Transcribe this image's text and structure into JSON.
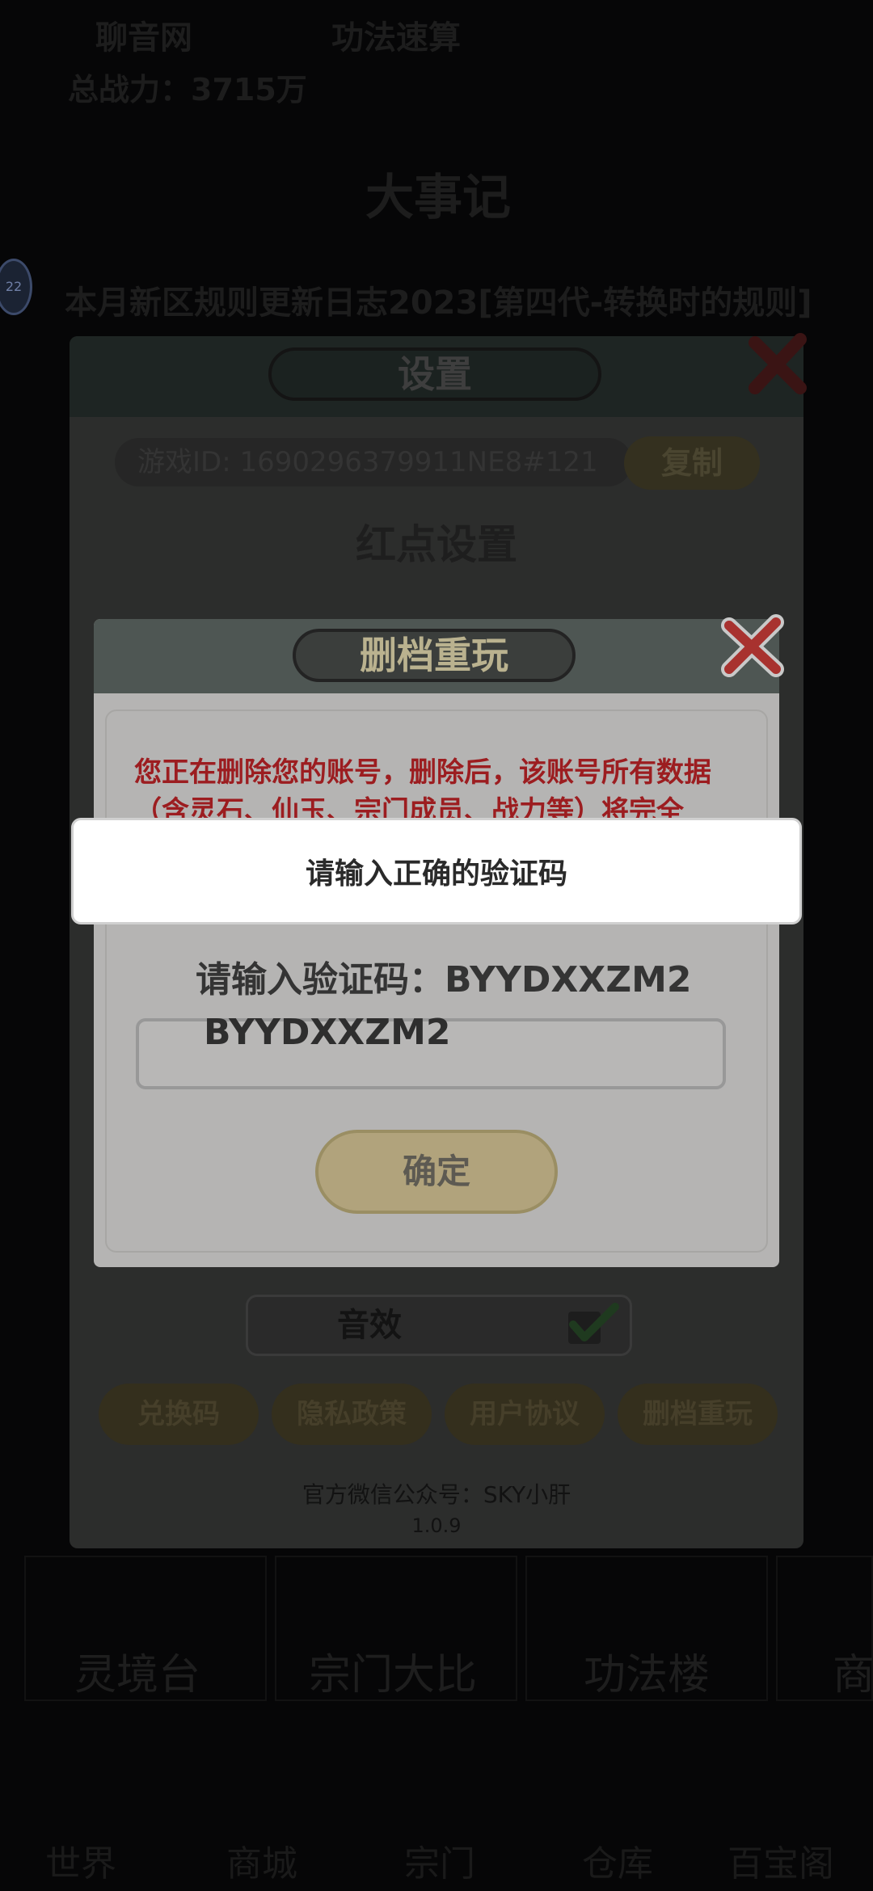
{
  "background": {
    "top_left": "聊音网",
    "top_center": "功法速算",
    "power": "总战力：3715万",
    "event_title": "大事记",
    "avatar_level": "22",
    "marquee": "本月新区规则更新日志2023[第四代-转换时的规则]",
    "menu": [
      "灵境台",
      "宗门大比",
      "功法楼",
      "商"
    ],
    "bottom": [
      "世界",
      "商城",
      "宗门",
      "仓库",
      "百宝阁"
    ]
  },
  "settings": {
    "title": "设置",
    "game_id": "游戏ID: 1690296379911NE8#121",
    "copy_label": "复制",
    "red_dot_title": "红点设置",
    "sound_label": "音效",
    "buttons": [
      "兑换码",
      "隐私政策",
      "用户协议",
      "删档重玩"
    ],
    "wechat": "官方微信公众号：SKY小肝",
    "version": "1.0.9"
  },
  "dialog": {
    "title": "删档重玩",
    "warning": "您正在删除您的账号，删除后，该账号所有数据（含灵石、仙玉、宗门成员、战力等）将完全",
    "verify_label": "请输入验证码：BYYDXXZM2",
    "input_value": "BYYDXXZM2",
    "confirm_label": "确定"
  },
  "toast": {
    "message": "请输入正确的验证码"
  },
  "colors": {
    "warning_red": "#9c1d20",
    "confirm_gold": "#b1a37c",
    "close_red": "#a8322f"
  }
}
